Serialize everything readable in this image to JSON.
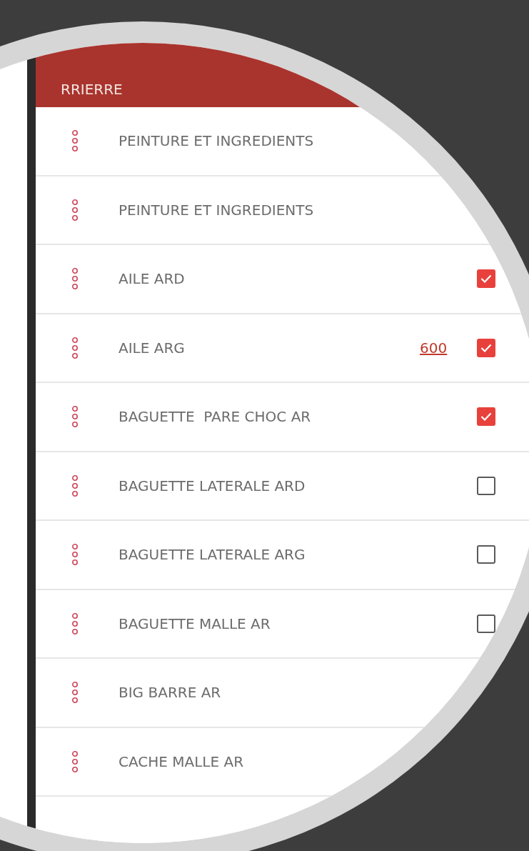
{
  "header": {
    "title": "RRIERRE"
  },
  "rows": [
    {
      "label": "PEINTURE ET INGREDIENTS"
    },
    {
      "label": "PEINTURE ET INGREDIENTS"
    },
    {
      "label": "AILE ARD",
      "checked": true
    },
    {
      "label": "AILE ARG",
      "amount": "600",
      "checked": true
    },
    {
      "label": "BAGUETTE  PARE CHOC AR",
      "checked": true
    },
    {
      "label": "BAGUETTE LATERALE ARD",
      "checked": false
    },
    {
      "label": "BAGUETTE LATERALE ARG",
      "checked": false
    },
    {
      "label": "BAGUETTE MALLE AR",
      "checked": false
    },
    {
      "label": "BIG BARRE AR"
    },
    {
      "label": "CACHE MALLE AR"
    }
  ]
}
